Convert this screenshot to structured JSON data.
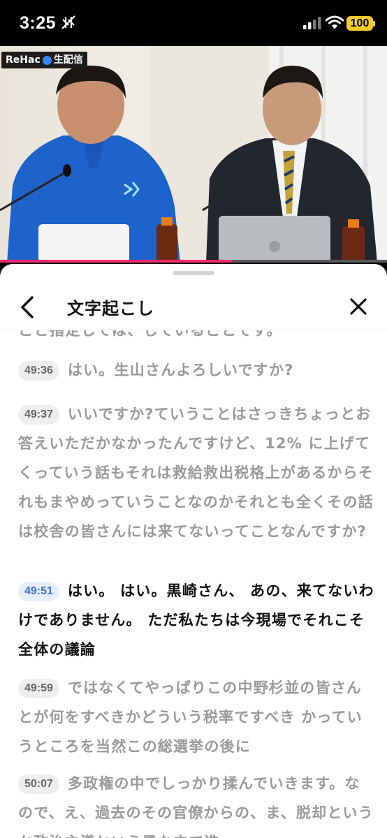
{
  "status_bar": {
    "time": "3:25",
    "battery": "100",
    "icons": [
      "mute-icon",
      "signal-icon",
      "wifi-icon",
      "battery-icon"
    ]
  },
  "video": {
    "channel_badge": "ReHac",
    "channel_badge_suffix": "生配信",
    "progress": 0.6
  },
  "sheet": {
    "title": "文字起こし",
    "back_icon": "chevron-left-icon",
    "close_icon": "close-icon",
    "cut_line": "こと指定しては、していることです。"
  },
  "transcript": [
    {
      "time": "49:36",
      "text": "はい。生山さんよろしいですか?",
      "active": false
    },
    {
      "time": "49:37",
      "text": "いいですか?ていうことはさっきちょっとお答えいただかなかったんですけど、12% に上げてくっていう話もそれは救給救出税格上があるからそれもまやめっていうことなのかそれとも全くその話は校舎の皆さんには来てないってことなんですか?",
      "active": false
    },
    {
      "time": "49:51",
      "text": "はい。 はい。黒崎さん、 あの、来てないわけでありません。 ただ私たちは今現場でそれこそ全体の議論",
      "active": true
    },
    {
      "time": "49:59",
      "text": "ではなくてやっぱりこの中野杉並の皆さん とが何をすべきかどういう税率ですべき かっていうところを当然この総選挙の後に",
      "active": false
    },
    {
      "time": "50:07",
      "text": "多政権の中でしっかり揉んでいきます。な ので、え、過去のその官僚からの、ま、脱却というか政治主導という風な中で進",
      "active": false
    }
  ],
  "colors": {
    "accent": "#ff2b6a",
    "active_timestamp_text": "#3f6fd6",
    "active_timestamp_bg": "#e6eefc",
    "inactive_text": "#9a9a9a",
    "battery": "#f3cc2b"
  }
}
